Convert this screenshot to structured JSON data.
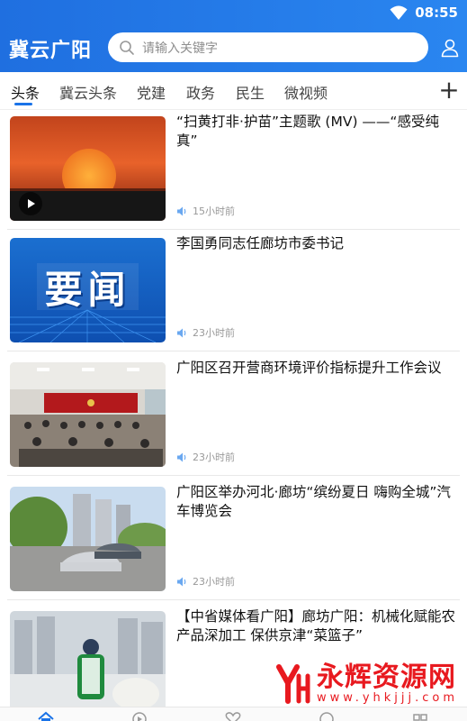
{
  "status": {
    "time": "08:55"
  },
  "header": {
    "title": "冀云广阳",
    "search_placeholder": "请输入关键字"
  },
  "tabs": [
    {
      "label": "头条",
      "active": true
    },
    {
      "label": "冀云头条",
      "active": false
    },
    {
      "label": "党建",
      "active": false
    },
    {
      "label": "政务",
      "active": false
    },
    {
      "label": "民生",
      "active": false
    },
    {
      "label": "微视频",
      "active": false
    }
  ],
  "news": [
    {
      "title": "“扫黄打非·护苗”主题歌 (MV) ——“感受纯真”",
      "time": "15小时前",
      "thumb": "sunset-video",
      "has_video": true
    },
    {
      "title": "李国勇同志任廊坊市委书记",
      "time": "23小时前",
      "thumb": "yaowen",
      "thumb_text": "要闻"
    },
    {
      "title": "广阳区召开营商环境评价指标提升工作会议",
      "time": "23小时前",
      "thumb": "meeting"
    },
    {
      "title": "广阳区举办河北·廊坊“缤纷夏日 嗨购全城”汽车博览会",
      "time": "23小时前",
      "thumb": "car-expo"
    },
    {
      "title": "【中省媒体看广阳】廊坊广阳：机械化赋能农产品深加工 保供京津“菜篮子”",
      "time": "",
      "thumb": "factory"
    }
  ],
  "watermark": {
    "name": "永辉资源网",
    "url": "www.yhkjjj.com"
  },
  "colors": {
    "brand": "#1f6fe0",
    "accent": "#1a73e8",
    "watermark": "#e8191f"
  }
}
